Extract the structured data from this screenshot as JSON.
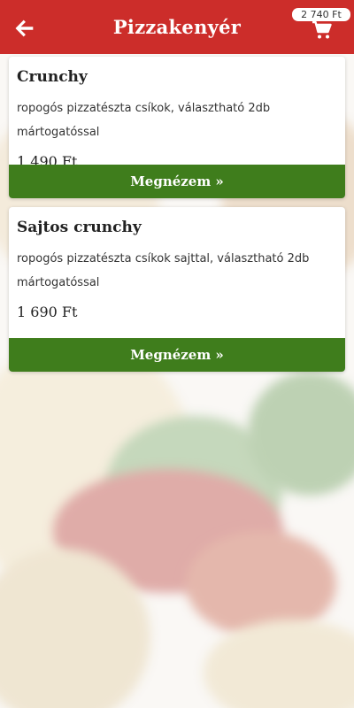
{
  "header": {
    "title": "Pizzakenyér",
    "cart_total": "2 740 Ft",
    "back_icon": "arrow-left-icon",
    "cart_icon": "shopping-cart-icon",
    "color": "#cc2d2a"
  },
  "products": [
    {
      "name": "Crunchy",
      "description": "ropogós pizzatészta csíkok, választható 2db mártogatóssal",
      "price": "1 490 Ft",
      "button_label": "Megnézem »"
    },
    {
      "name": "Sajtos crunchy",
      "description": "ropogós pizzatészta csíkok sajttal, választható 2db mártogatóssal",
      "price": "1 690 Ft",
      "button_label": "Megnézem »"
    }
  ],
  "colors": {
    "accent_green": "#3f7d1c",
    "header_red": "#cc2d2a"
  }
}
